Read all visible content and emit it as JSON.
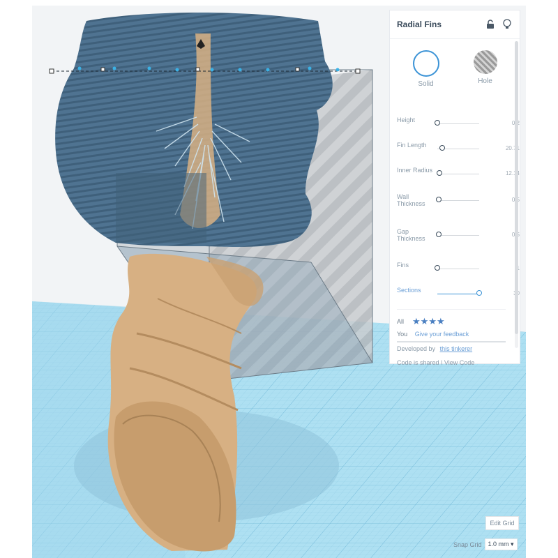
{
  "inspector": {
    "title": "Radial Fins",
    "shapes": {
      "solid_label": "Solid",
      "hole_label": "Hole"
    },
    "params": [
      {
        "label": "Height",
        "value": "0.2",
        "level": 0.0
      },
      {
        "label": "Fin Length",
        "value": "20.71",
        "level": 0.12
      },
      {
        "label": "Inner Radius",
        "value": "12.14",
        "level": 0.05
      },
      {
        "label": "Wall Thickness",
        "value": "0.5",
        "level": 0.03
      },
      {
        "label": "Gap Thickness",
        "value": "0.5",
        "level": 0.03
      },
      {
        "label": "Fins",
        "value": "1",
        "level": 0.0
      },
      {
        "label": "Sections",
        "value": "30",
        "level": 1.0
      }
    ],
    "rating": {
      "label": "All",
      "stars": "★★★★"
    },
    "you_label": "You",
    "feedback_link": "Give your feedback",
    "developer_prefix": "Developed by",
    "developer_link": "this tinkerer",
    "code_text": "Code is shared | View Code"
  },
  "footer": {
    "edit_grid": "Edit Grid",
    "snap_label": "Snap Grid",
    "snap_value": "1.0 mm ▾"
  },
  "edge_arrows": "›\n‹",
  "colors": {
    "grid": "#aee0f2",
    "fins": "#4f7391",
    "bust": "#d7b083",
    "accent": "#3b93d6"
  },
  "icons": {
    "lock": "lock-icon",
    "bulb": "lightbulb-icon",
    "rotate": "rotate-icon"
  }
}
